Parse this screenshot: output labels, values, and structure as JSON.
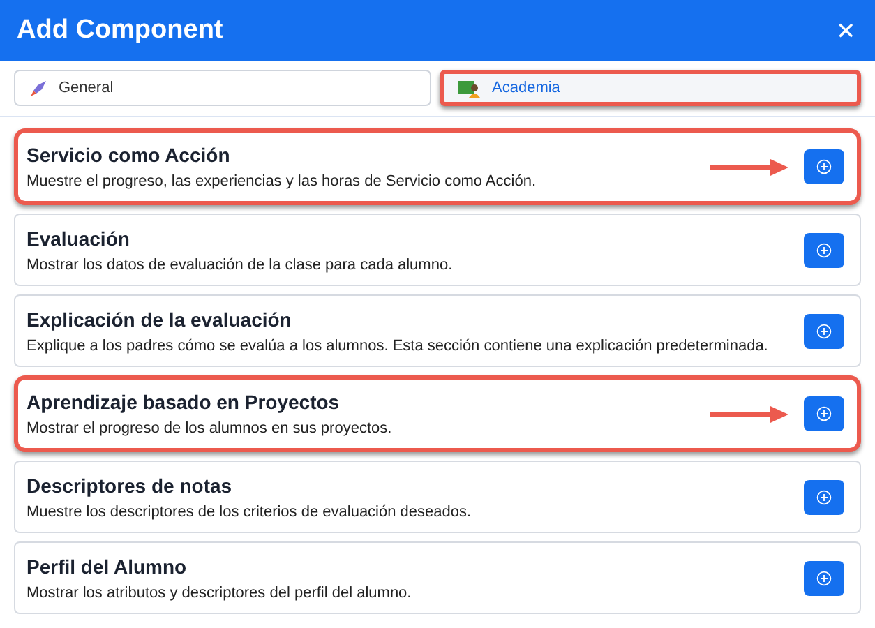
{
  "dialog": {
    "title": "Add Component",
    "close": "✕"
  },
  "tabs": [
    {
      "label": "General",
      "selected": false,
      "highlighted": false
    },
    {
      "label": "Academia",
      "selected": true,
      "highlighted": true
    }
  ],
  "components": [
    {
      "title": "Servicio como Acción",
      "description": "Muestre el progreso, las experiencias y las horas de Servicio como Acción.",
      "highlighted": true
    },
    {
      "title": "Evaluación",
      "description": "Mostrar los datos de evaluación de la clase para cada alumno.",
      "highlighted": false
    },
    {
      "title": "Explicación de la evaluación",
      "description": "Explique a los padres cómo se evalúa a los alumnos. Esta sección contiene una explicación predeterminada.",
      "highlighted": false
    },
    {
      "title": "Aprendizaje basado en Proyectos",
      "description": "Mostrar el progreso de los alumnos en sus proyectos.",
      "highlighted": true
    },
    {
      "title": "Descriptores de notas",
      "description": "Muestre los descriptores de los criterios de evaluación deseados.",
      "highlighted": false
    },
    {
      "title": "Perfil del Alumno",
      "description": "Mostrar los atributos y descriptores del perfil del alumno.",
      "highlighted": false
    }
  ]
}
